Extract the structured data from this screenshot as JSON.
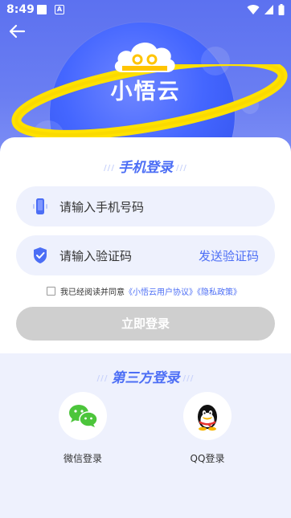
{
  "status_bar": {
    "time": "8:49",
    "a_icon_letter": "A"
  },
  "brand": {
    "name": "小悟云"
  },
  "login": {
    "title": "手机登录",
    "deco": "///",
    "phone_placeholder": "请输入手机号码",
    "code_placeholder": "请输入验证码",
    "send_code_label": "发送验证码",
    "agreement_prefix": "我已经阅读并同意",
    "agreement_user": "《小悟云用户协议》",
    "agreement_privacy": "《隐私政策》",
    "submit_label": "立即登录"
  },
  "third_party": {
    "title": "第三方登录",
    "options": [
      {
        "label": "微信登录",
        "icon": "wechat-icon"
      },
      {
        "label": "QQ登录",
        "icon": "qq-icon"
      }
    ]
  },
  "colors": {
    "accent": "#4c6ef5",
    "hero": "#6a7ef2",
    "planet": "#4466ff",
    "ring": "#ffe100",
    "button_disabled": "#cfcfcf",
    "field_bg": "#eef1fd",
    "wechat": "#4cc53b"
  }
}
